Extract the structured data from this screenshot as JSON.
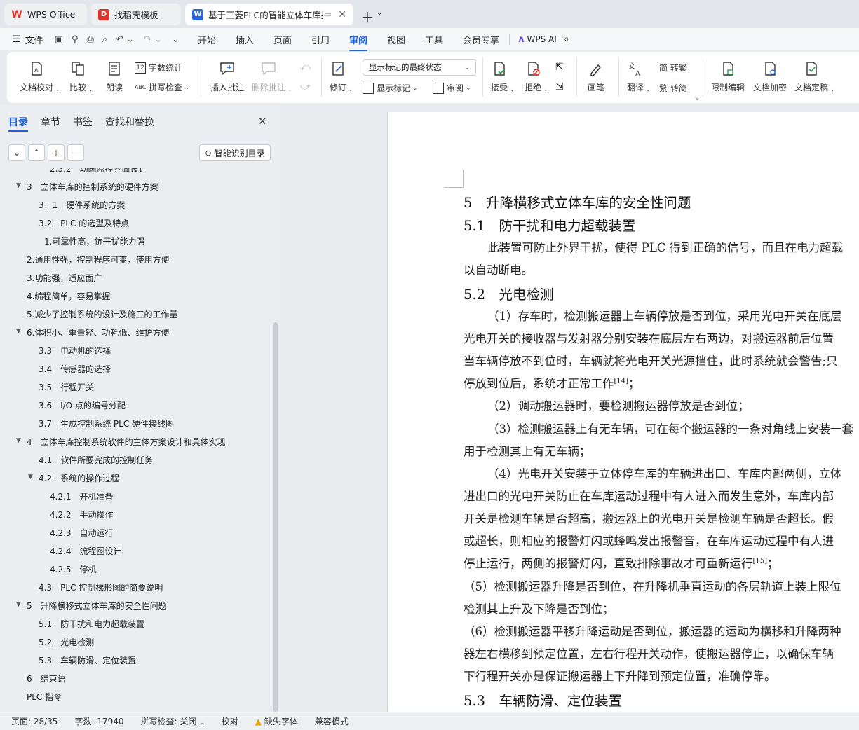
{
  "tabs": [
    {
      "label": "WPS Office",
      "icon": "wps-logo-icon"
    },
    {
      "label": "找稻壳模板",
      "icon": "docer-icon"
    },
    {
      "label": "基于三菱PLC的智能立体车库控",
      "icon": "writer-icon"
    }
  ],
  "menu": {
    "file": "文件",
    "items": [
      "开始",
      "插入",
      "页面",
      "引用",
      "审阅",
      "视图",
      "工具",
      "会员专享"
    ],
    "active": "审阅",
    "ai": "WPS AI"
  },
  "ribbon": {
    "doc_check": "文档校对",
    "compare": "比较",
    "read_aloud": "朗读",
    "word_count": "字数统计",
    "spell_check": "拼写检查",
    "insert_comment": "插入批注",
    "delete_comment": "删除批注",
    "track": "修订",
    "markup_state": "显示标记的最终状态",
    "show_markup": "显示标记",
    "review": "审阅",
    "accept": "接受",
    "reject": "拒绝",
    "pen": "画笔",
    "translate": "翻译",
    "to_traditional": "简 转繁",
    "to_simplified": "繁 转简",
    "restrict": "限制编辑",
    "encrypt": "文档加密",
    "finalize": "文档定稿"
  },
  "sidebar": {
    "tabs": [
      "目录",
      "章节",
      "书签",
      "查找和替换"
    ],
    "smart_toc": "智能识别目录",
    "toc": [
      {
        "text": "2.3.2　动画监控界面设计",
        "level": 3,
        "arrow": ""
      },
      {
        "text": "3　立体车库的控制系统的硬件方案",
        "level": 1,
        "arrow": "▼"
      },
      {
        "text": "3．1　硬件系统的方案",
        "level": 2,
        "arrow": ""
      },
      {
        "text": "3.2　PLC 的选型及特点",
        "level": 2,
        "arrow": ""
      },
      {
        "text": "1.可靠性高，抗干扰能力强",
        "level": 2.5,
        "arrow": ""
      },
      {
        "text": "2.通用性强，控制程序可变，使用方便",
        "level": 1,
        "arrow": ""
      },
      {
        "text": "3.功能强，适应面广",
        "level": 1,
        "arrow": ""
      },
      {
        "text": "4.编程简单，容易掌握",
        "level": 1,
        "arrow": ""
      },
      {
        "text": "5.减少了控制系统的设计及施工的工作量",
        "level": 1,
        "arrow": ""
      },
      {
        "text": "6.体积小、重量轻、功耗低、维护方便",
        "level": 1,
        "arrow": "▼"
      },
      {
        "text": "3.3　电动机的选择",
        "level": 2,
        "arrow": ""
      },
      {
        "text": "3.4　传感器的选择",
        "level": 2,
        "arrow": ""
      },
      {
        "text": "3.5　行程开关",
        "level": 2,
        "arrow": ""
      },
      {
        "text": "3.6　I/O 点的编号分配",
        "level": 2,
        "arrow": ""
      },
      {
        "text": "3.7　生成控制系统 PLC 硬件接线图",
        "level": 2,
        "arrow": ""
      },
      {
        "text": "4　立体车库控制系统软件的主体方案设计和具体实现",
        "level": 1,
        "arrow": "▼"
      },
      {
        "text": "4.1　软件所要完成的控制任务",
        "level": 2,
        "arrow": ""
      },
      {
        "text": "4.2　系统的操作过程",
        "level": 2,
        "arrow": "▼"
      },
      {
        "text": "4.2.1　开机准备",
        "level": 3,
        "arrow": ""
      },
      {
        "text": "4.2.2　手动操作",
        "level": 3,
        "arrow": ""
      },
      {
        "text": "4.2.3　自动运行",
        "level": 3,
        "arrow": ""
      },
      {
        "text": "4.2.4　流程图设计",
        "level": 3,
        "arrow": ""
      },
      {
        "text": "4.2.5　停机",
        "level": 3,
        "arrow": ""
      },
      {
        "text": "4.3　PLC 控制梯形图的简要说明",
        "level": 2,
        "arrow": ""
      },
      {
        "text": "5　升降横移式立体车库的安全性问题",
        "level": 1,
        "arrow": "▼"
      },
      {
        "text": "5.1　防干扰和电力超载装置",
        "level": 2,
        "arrow": ""
      },
      {
        "text": "5.2　光电检测",
        "level": 2,
        "arrow": ""
      },
      {
        "text": "5.3　车辆防滑、定位装置",
        "level": 2,
        "arrow": ""
      },
      {
        "text": "6　结束语",
        "level": 1,
        "arrow": ""
      },
      {
        "text": "PLC 指令",
        "level": 1,
        "arrow": ""
      }
    ]
  },
  "document": {
    "h1": "5　升降横移式立体车库的安全性问题",
    "h2_1": "5.1　防干扰和电力超载装置",
    "p1a": "此装置可防止外界干扰，使得 PLC 得到正确的信号，而且在电力超载",
    "p1b": "以自动断电。",
    "h2_2": "5.2　光电检测",
    "p2a": "（1）存车时，检测搬运器上车辆停放是否到位，采用光电开关在底层",
    "p2b": "光电开关的接收器与发射器分别安装在底层左右两边，对搬运器前后位置",
    "p2c": "当车辆停放不到位时，车辆就将光电开关光源挡住，此时系统就会警告;只",
    "p2d": "停放到位后，系统才正常工作",
    "ref14": "[14]",
    "p2d_end": "；",
    "p3": "（2）调动搬运器时，要检测搬运器停放是否到位；",
    "p4a": "（3）检测搬运器上有无车辆，可在每个搬运器的一条对角线上安装一套",
    "p4b": "用于检测其上有无车辆；",
    "p5a": "（4）光电开关安装于立体停车库的车辆进出口、车库内部两侧，立体",
    "p5b": "进出口的光电开关防止在车库运动过程中有人进入而发生意外，车库内部",
    "p5c": "开关是检测车辆是否超高，搬运器上的光电开关是检测车辆是否超长。假",
    "p5d": "或超长，则相应的报警灯闪或蜂鸣发出报警音，在车库运动过程中有人进",
    "p5e": "停止运行，两侧的报警灯闪，直致排除事故才可重新运行",
    "ref15": "[15]",
    "p5e_end": "；",
    "p6a": "（5）检测搬运器升降是否到位，在升降机垂直运动的各层轨道上装上限位",
    "p6b": "检测其上升及下降是否到位；",
    "p7a": "（6）检测搬运器平移升降运动是否到位，搬运器的运动为横移和升降两种",
    "p7b": "器左右横移到预定位置，左右行程开关动作，使搬运器停止，以确保车辆",
    "p7c": "下行程开关亦是保证搬运器上下升降到预定位置，准确停靠。",
    "h2_3": "5.3　车辆防滑、定位装置"
  },
  "status": {
    "page": "页面: 28/35",
    "words": "字数: 17940",
    "spell": "拼写检查: 关闭",
    "proof": "校对",
    "missing_font": "缺失字体",
    "compat": "兼容模式"
  },
  "colors": {
    "accent": "#2261d6",
    "wps_red": "#e0322b",
    "writer_blue": "#2b63d9"
  }
}
